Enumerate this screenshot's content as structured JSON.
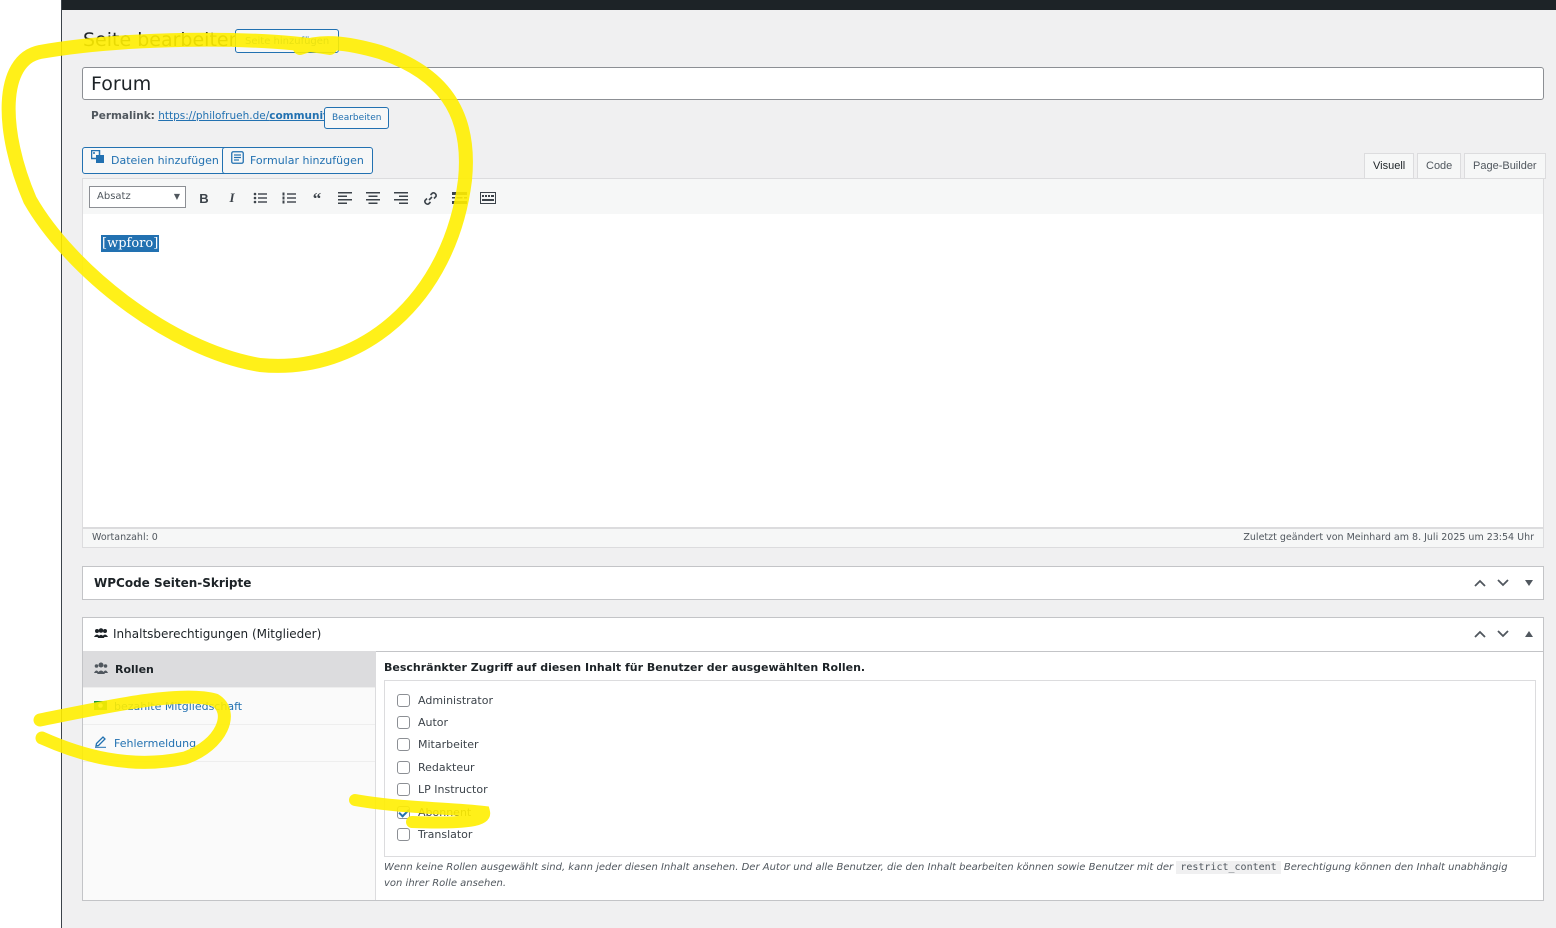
{
  "header": {
    "title": "Seite bearbeiten",
    "add_button": "Seite hinzufügen"
  },
  "post": {
    "title": "Forum"
  },
  "permalink": {
    "label": "Permalink:",
    "url_prefix": "https://philofrueh.de/",
    "url_slug": "community",
    "url_suffix": "/",
    "edit_button": "Bearbeiten"
  },
  "media": {
    "add_files": "Dateien hinzufügen",
    "add_form": "Formular hinzufügen"
  },
  "editor_tabs": {
    "visual": "Visuell",
    "code": "Code",
    "page_builder": "Page-Builder",
    "active": "Visuell"
  },
  "toolbar": {
    "format_select": "Absatz",
    "buttons": [
      "bold-icon",
      "italic-icon",
      "bullet-list-icon",
      "numbered-list-icon",
      "blockquote-icon",
      "align-left-icon",
      "align-center-icon",
      "align-right-icon",
      "link-icon",
      "read-more-icon",
      "toolbar-toggle-icon"
    ]
  },
  "content": {
    "text": "[wpforo]"
  },
  "status": {
    "word_count": "Wortanzahl: 0",
    "last_modified": "Zuletzt geändert von Meinhard am 8. Juli 2025 um 23:54 Uhr"
  },
  "wpcode_box": {
    "title": "WPCode Seiten-Skripte"
  },
  "permissions_box": {
    "title": "Inhaltsberechtigungen (Mitglieder)",
    "tabs": [
      {
        "label": "Rollen",
        "icon": "users-icon",
        "active": true
      },
      {
        "label": "bezahlte Mitgliedschaft",
        "icon": "money-icon",
        "active": false
      },
      {
        "label": "Fehlermeldung",
        "icon": "edit-icon",
        "active": false
      }
    ],
    "heading": "Beschränkter Zugriff auf diesen Inhalt für Benutzer der ausgewählten Rollen.",
    "roles": [
      {
        "label": "Administrator",
        "checked": false
      },
      {
        "label": "Autor",
        "checked": false
      },
      {
        "label": "Mitarbeiter",
        "checked": false
      },
      {
        "label": "Redakteur",
        "checked": false
      },
      {
        "label": "LP Instructor",
        "checked": false
      },
      {
        "label": "Abonnent",
        "checked": true
      },
      {
        "label": "Translator",
        "checked": false
      }
    ],
    "note_before": "Wenn keine Rollen ausgewählt sind, kann jeder diesen Inhalt ansehen. Der Autor und alle Benutzer, die den Inhalt bearbeiten können sowie Benutzer mit der",
    "note_code": "restrict_content",
    "note_after": "Berechtigung können den Inhalt unabhängig von ihrer Rolle ansehen."
  },
  "colors": {
    "accent": "#2271b1",
    "highlight": "#ffee00",
    "background": "#f0f0f1",
    "admin_bar": "#1d2327"
  }
}
